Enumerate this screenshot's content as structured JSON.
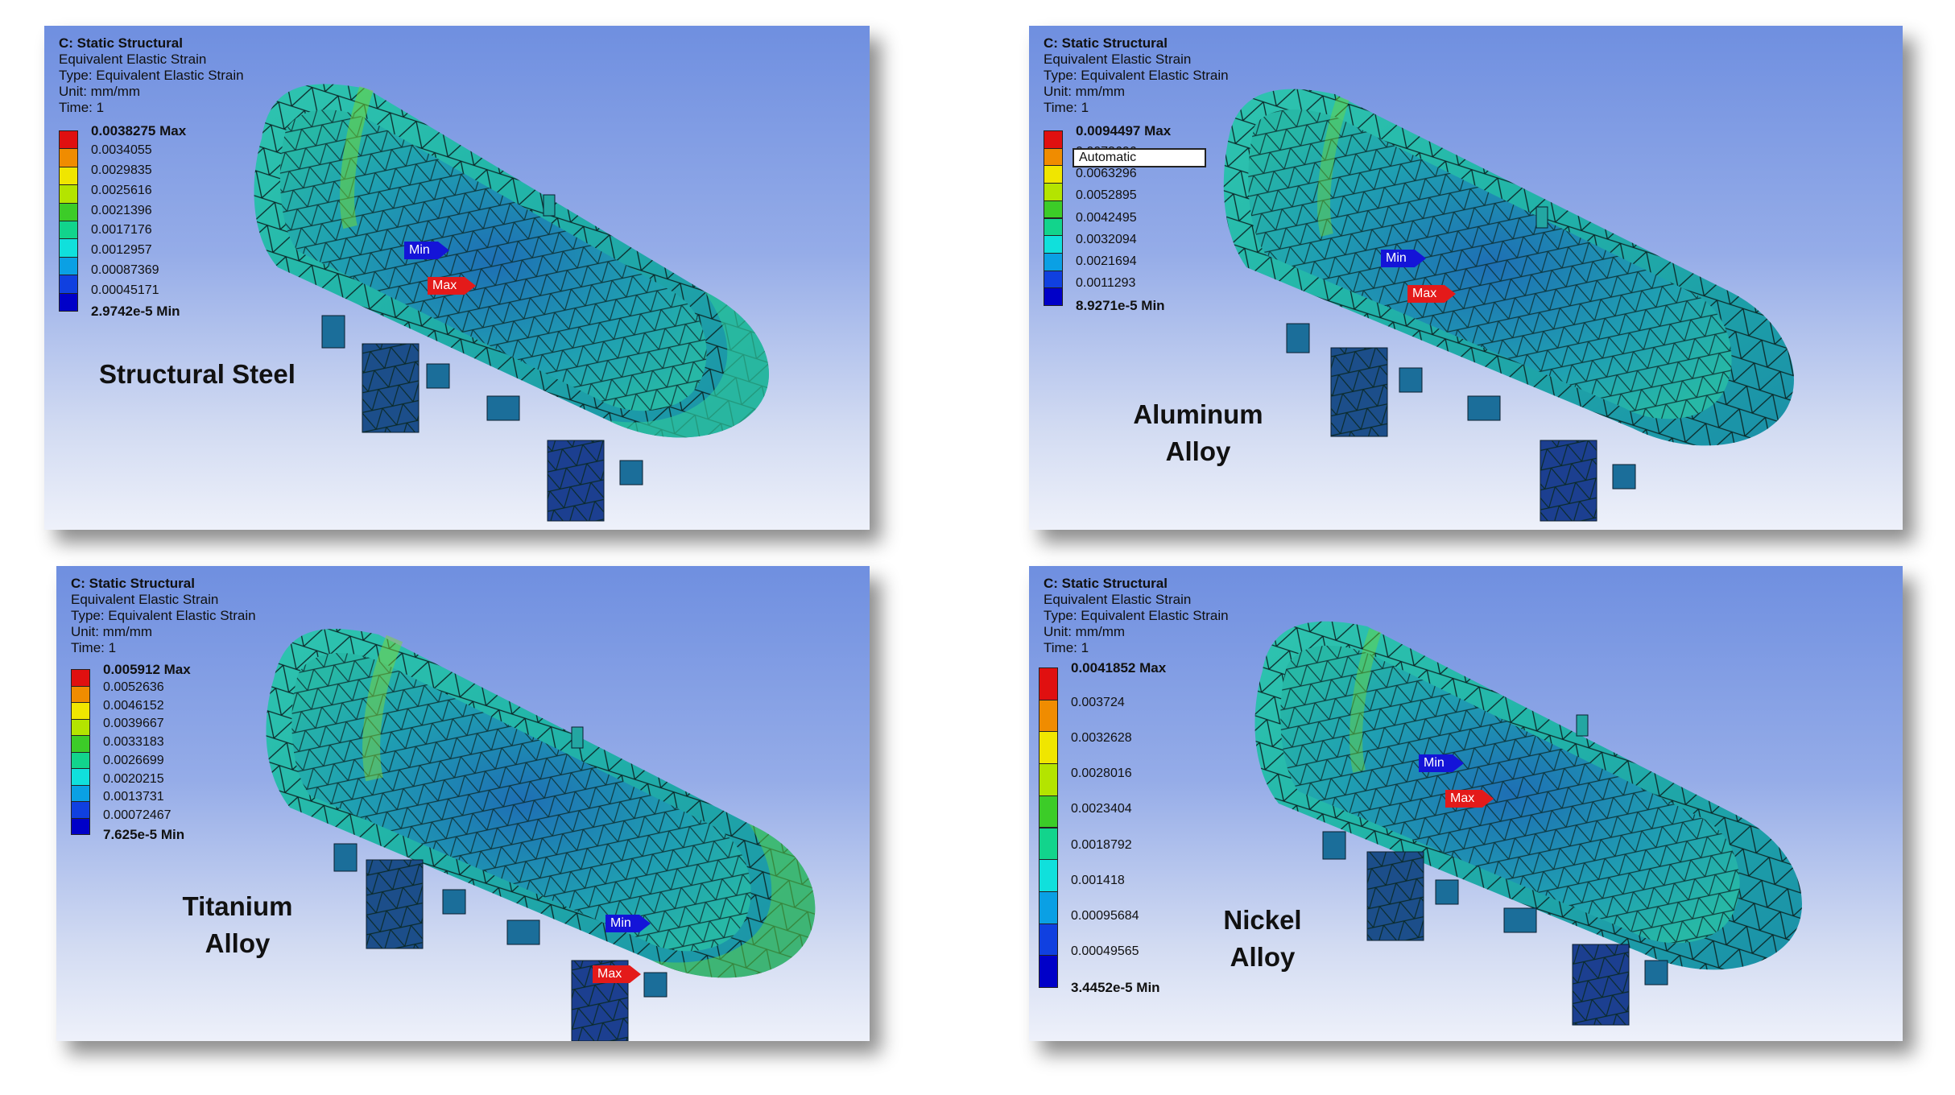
{
  "common": {
    "line1": "C: Static Structural",
    "line2": "Equivalent Elastic Strain",
    "line3": "Type: Equivalent Elastic Strain",
    "line4": "Unit: mm/mm",
    "line5": "Time: 1",
    "min_tag": "Min",
    "max_tag": "Max"
  },
  "legend_colors": [
    "#e01010",
    "#f08c00",
    "#f0e600",
    "#b4e400",
    "#3ccc28",
    "#12d48c",
    "#10e0dc",
    "#0aa0e4",
    "#1040e0",
    "#0000c8"
  ],
  "panels": [
    {
      "material": "Structural Steel",
      "max": "0.0038275 Max",
      "values": [
        "0.0034055",
        "0.0029835",
        "0.0025616",
        "0.0021396",
        "0.0017176",
        "0.0012957",
        "0.00087369",
        "0.00045171"
      ],
      "min": "2.9742e-5 Min"
    },
    {
      "material_line1": "Aluminum",
      "material_line2": "Alloy",
      "max": "0.0094497 Max",
      "automatic": "Automatic",
      "values": [
        "0.0073696",
        "0.0063296",
        "0.0052895",
        "0.0042495",
        "0.0032094",
        "0.0021694",
        "0.0011293"
      ],
      "min": "8.9271e-5 Min"
    },
    {
      "material_line1": "Titanium",
      "material_line2": "Alloy",
      "max": "0.005912 Max",
      "values": [
        "0.0052636",
        "0.0046152",
        "0.0039667",
        "0.0033183",
        "0.0026699",
        "0.0020215",
        "0.0013731",
        "0.00072467"
      ],
      "min": "7.625e-5 Min"
    },
    {
      "material_line1": "Nickel",
      "material_line2": "Alloy",
      "max": "0.0041852 Max",
      "values": [
        "0.003724",
        "0.0032628",
        "0.0028016",
        "0.0023404",
        "0.0018792",
        "0.001418",
        "0.00095684",
        "0.00049565"
      ],
      "min": "3.4452e-5 Min"
    }
  ]
}
